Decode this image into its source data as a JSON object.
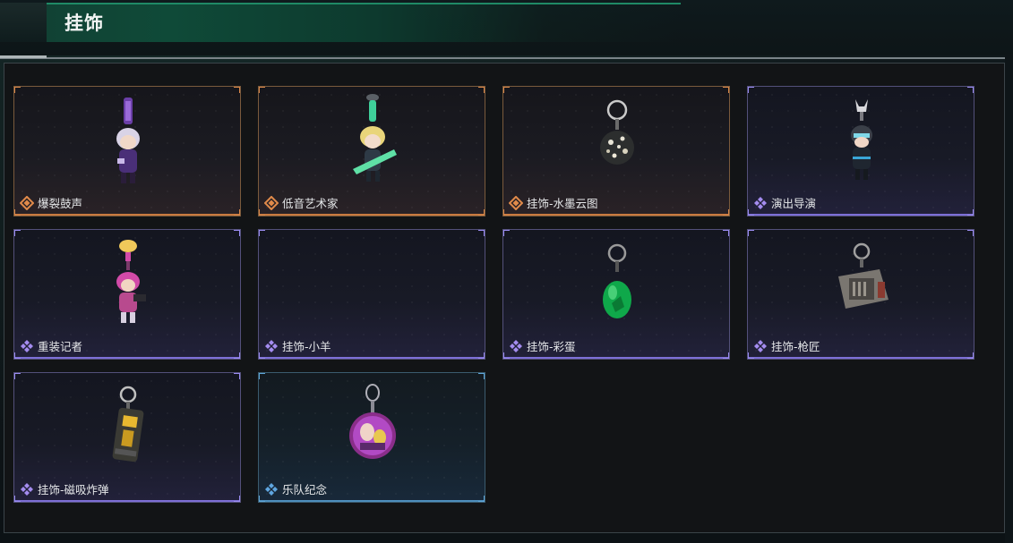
{
  "header": {
    "title": "挂饰"
  },
  "items": [
    {
      "name": "爆裂鼓声",
      "rarity": "orange",
      "icon": "diamond-cross-icon",
      "art": "drummer-charm"
    },
    {
      "name": "低音艺术家",
      "rarity": "orange",
      "icon": "diamond-cross-icon",
      "art": "guitarist-charm"
    },
    {
      "name": "挂饰-水墨云图",
      "rarity": "orange",
      "icon": "diamond-cross-icon",
      "art": "ink-ball-charm"
    },
    {
      "name": "演出导演",
      "rarity": "purple",
      "icon": "four-diamond-icon",
      "art": "director-charm"
    },
    {
      "name": "重装记者",
      "rarity": "purple",
      "icon": "four-diamond-icon",
      "art": "reporter-charm"
    },
    {
      "name": "挂饰-小羊",
      "rarity": "purple",
      "icon": "four-diamond-icon",
      "art": "empty"
    },
    {
      "name": "挂饰-彩蛋",
      "rarity": "purple",
      "icon": "four-diamond-icon",
      "art": "egg-charm"
    },
    {
      "name": "挂饰-枪匠",
      "rarity": "purple",
      "icon": "four-diamond-icon",
      "art": "gunsmith-charm"
    },
    {
      "name": "挂饰-磁吸炸弹",
      "rarity": "purple",
      "icon": "four-diamond-icon",
      "art": "bomb-charm"
    },
    {
      "name": "乐队纪念",
      "rarity": "blue",
      "icon": "four-diamond-icon",
      "art": "band-badge-charm"
    }
  ],
  "colors": {
    "orange": "#e08a4a",
    "purple": "#a48cf0",
    "blue": "#5fa6e0"
  }
}
